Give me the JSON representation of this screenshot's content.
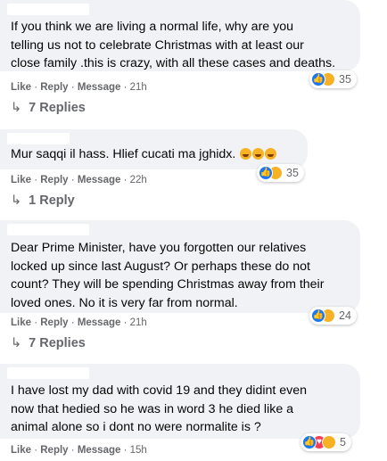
{
  "comments": [
    {
      "text": "If you think we are living a normal life, why are you\ntelling us not to celebrate Christmas with at least our\nclose family .this is crazy, with all these cases and deaths.",
      "like": "Like",
      "reply": "Reply",
      "message": "Message",
      "time": "21h",
      "reaction_icons": [
        "like-icon",
        "haha-icon"
      ],
      "reaction_count": "35",
      "replies": "7 Replies"
    },
    {
      "text": "Mur saqqi il hass. Hlief cucati ma jghidx.",
      "inline_emoji": [
        "rofl-emoji",
        "rofl-emoji",
        "rofl-emoji"
      ],
      "like": "Like",
      "reply": "Reply",
      "message": "Message",
      "time": "22h",
      "reaction_icons": [
        "like-icon",
        "haha-icon"
      ],
      "reaction_count": "35",
      "replies": "1 Reply"
    },
    {
      "text": "Dear Prime Minister, have you forgotten our relatives\nlocked up since last August? Or perhaps these do not\ncount? They will be spending Christmas away from their\nloved ones. No it is very far from normal.",
      "like": "Like",
      "reply": "Reply",
      "message": "Message",
      "time": "21h",
      "reaction_icons": [
        "like-icon",
        "sad-icon"
      ],
      "reaction_count": "24",
      "replies": "7 Replies"
    },
    {
      "text": "I have lost my dad with covid 19 and they didint even\nnow that hedied so he was in word 3 he died like a\nanimal alone so i dont no were normalite is ?",
      "like": "Like",
      "reply": "Reply",
      "message": "Message",
      "time": "15h",
      "reaction_icons": [
        "like-icon",
        "love-icon",
        "sad-icon"
      ],
      "reaction_count": "5"
    }
  ],
  "colors": {
    "bubble": "#f0f2f5",
    "meta": "#65676b",
    "like_blue": "#1877f2",
    "haha_yellow": "#f7b125",
    "love_red": "#f33e58"
  }
}
